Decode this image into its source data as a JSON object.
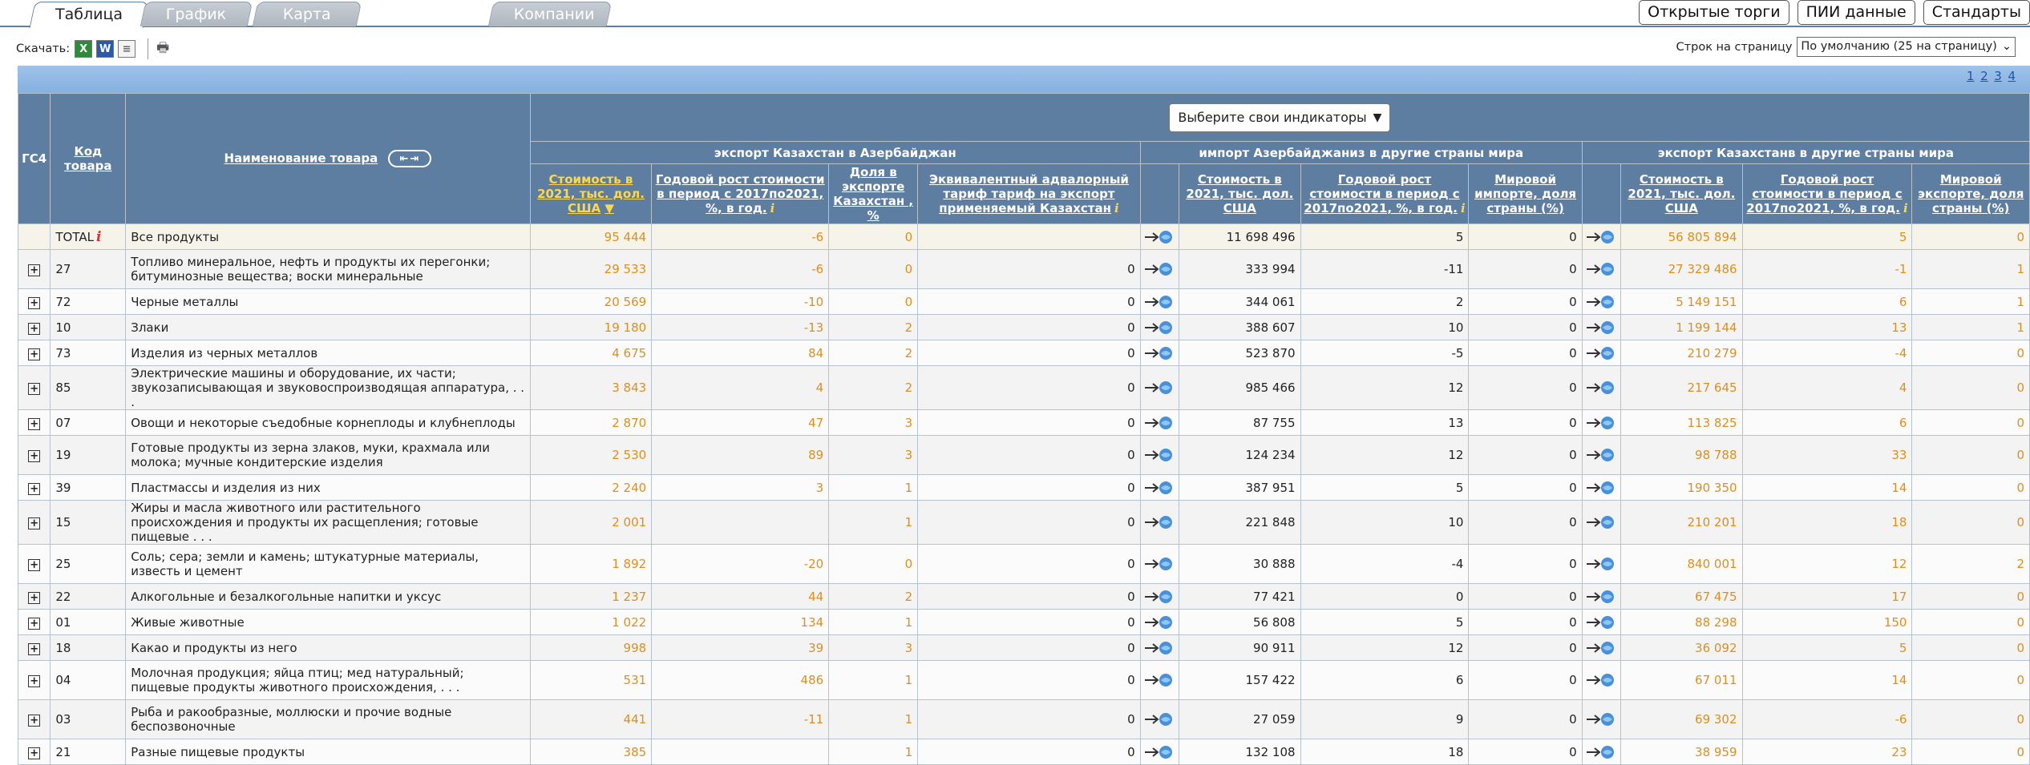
{
  "tabs": [
    {
      "label": "Таблица",
      "active": true
    },
    {
      "label": "График",
      "active": false
    },
    {
      "label": "Карта",
      "active": false
    },
    {
      "label": "Компании",
      "active": false
    }
  ],
  "top_buttons": [
    "Открытые торги",
    "ПИИ данные",
    "Стандарты"
  ],
  "toolbar": {
    "download_label": "Скачать:",
    "icons": [
      "excel-icon",
      "word-icon",
      "text-file-icon",
      "print-icon"
    ],
    "rows_label": "Строк на страницу",
    "rows_value": "По умолчанию (25 на страницу)"
  },
  "pager": [
    "1",
    "2",
    "3",
    "4"
  ],
  "header": {
    "col_gc4": "ГС4",
    "col_code": "Код товара",
    "col_name": "Наименование товара",
    "indicator_button": "Выберите свои индикаторы",
    "group1": "экспорт Казахстан в Азербайджан",
    "group2": "импорт Азербайджаниз в другие страны мира",
    "group3": "экспорт Казахстанв в другие страны мира",
    "g1_cols": [
      "Стоимость в 2021, тыс. дол. США",
      "Годовой рост стоимости в период с 2017по2021, %, в год.",
      "Доля в экспорте Казахстан , %",
      "Эквивалентный адвалорный тариф тариф на экспорт применяемый Казахстан"
    ],
    "g2_cols": [
      "Стоимость в 2021, тыс. дол. США",
      "Годовой рост стоимости в период с 2017по2021, %, в год.",
      "Мировой импорте, доля страны (%)"
    ],
    "g3_cols": [
      "Стоимость в 2021, тыс. дол. США",
      "Годовой рост стоимости в период с 2017по2021, %, в год.",
      "Мировой экспорте, доля страны (%)"
    ]
  },
  "rows": [
    {
      "code": "TOTAL",
      "name": "Все продукты",
      "v1": "95 444",
      "g1": "-6",
      "s1": "0",
      "t1": "",
      "v2": "11 698 496",
      "g2": "5",
      "s2": "0",
      "v3": "56 805 894",
      "g3": "5",
      "s3": "0",
      "total": true
    },
    {
      "code": "27",
      "name": "Топливо минеральное, нефть и продукты их перегонки; битуминозные вещества; воски минеральные",
      "v1": "29 533",
      "g1": "-6",
      "s1": "0",
      "t1": "0",
      "v2": "333 994",
      "g2": "-11",
      "s2": "0",
      "v3": "27 329 486",
      "g3": "-1",
      "s3": "1",
      "tall": true
    },
    {
      "code": "72",
      "name": "Черные металлы",
      "v1": "20 569",
      "g1": "-10",
      "s1": "0",
      "t1": "0",
      "v2": "344 061",
      "g2": "2",
      "s2": "0",
      "v3": "5 149 151",
      "g3": "6",
      "s3": "1"
    },
    {
      "code": "10",
      "name": "Злаки",
      "v1": "19 180",
      "g1": "-13",
      "s1": "2",
      "t1": "0",
      "v2": "388 607",
      "g2": "10",
      "s2": "0",
      "v3": "1 199 144",
      "g3": "13",
      "s3": "1"
    },
    {
      "code": "73",
      "name": "Изделия из черных металлов",
      "v1": "4 675",
      "g1": "84",
      "s1": "2",
      "t1": "0",
      "v2": "523 870",
      "g2": "-5",
      "s2": "0",
      "v3": "210 279",
      "g3": "-4",
      "s3": "0"
    },
    {
      "code": "85",
      "name": "Электрические машины и оборудование, их части; звукозаписывающая и звуковоспроизводящая аппаратура, . . .",
      "v1": "3 843",
      "g1": "4",
      "s1": "2",
      "t1": "0",
      "v2": "985 466",
      "g2": "12",
      "s2": "0",
      "v3": "217 645",
      "g3": "4",
      "s3": "0",
      "tall": true
    },
    {
      "code": "07",
      "name": "Овощи и некоторые съедобные корнеплоды и клубнеплоды",
      "v1": "2 870",
      "g1": "47",
      "s1": "3",
      "t1": "0",
      "v2": "87 755",
      "g2": "13",
      "s2": "0",
      "v3": "113 825",
      "g3": "6",
      "s3": "0"
    },
    {
      "code": "19",
      "name": "Готовые продукты из зерна злаков, муки, крахмала или молока; мучные кондитерские изделия",
      "v1": "2 530",
      "g1": "89",
      "s1": "3",
      "t1": "0",
      "v2": "124 234",
      "g2": "12",
      "s2": "0",
      "v3": "98 788",
      "g3": "33",
      "s3": "0",
      "tall": true
    },
    {
      "code": "39",
      "name": "Пластмассы и изделия из них",
      "v1": "2 240",
      "g1": "3",
      "s1": "1",
      "t1": "0",
      "v2": "387 951",
      "g2": "5",
      "s2": "0",
      "v3": "190 350",
      "g3": "14",
      "s3": "0"
    },
    {
      "code": "15",
      "name": "Жиры и масла животного или растительного происхождения и продукты их расщепления; готовые пищевые . . .",
      "v1": "2 001",
      "g1": "",
      "s1": "1",
      "t1": "0",
      "v2": "221 848",
      "g2": "10",
      "s2": "0",
      "v3": "210 201",
      "g3": "18",
      "s3": "0",
      "tall": true
    },
    {
      "code": "25",
      "name": "Соль; сера; земли и камень; штукатурные материалы, известь и цемент",
      "v1": "1 892",
      "g1": "-20",
      "s1": "0",
      "t1": "0",
      "v2": "30 888",
      "g2": "-4",
      "s2": "0",
      "v3": "840 001",
      "g3": "12",
      "s3": "2",
      "tall": true
    },
    {
      "code": "22",
      "name": "Алкогольные и безалкогольные напитки и уксус",
      "v1": "1 237",
      "g1": "44",
      "s1": "2",
      "t1": "0",
      "v2": "77 421",
      "g2": "0",
      "s2": "0",
      "v3": "67 475",
      "g3": "17",
      "s3": "0"
    },
    {
      "code": "01",
      "name": "Живые животные",
      "v1": "1 022",
      "g1": "134",
      "s1": "1",
      "t1": "0",
      "v2": "56 808",
      "g2": "5",
      "s2": "0",
      "v3": "88 298",
      "g3": "150",
      "s3": "0"
    },
    {
      "code": "18",
      "name": "Какао и продукты из него",
      "v1": "998",
      "g1": "39",
      "s1": "3",
      "t1": "0",
      "v2": "90 911",
      "g2": "12",
      "s2": "0",
      "v3": "36 092",
      "g3": "5",
      "s3": "0"
    },
    {
      "code": "04",
      "name": "Молочная продукция; яйца птиц; мед натуральный; пищевые продукты животного происхождения, . . .",
      "v1": "531",
      "g1": "486",
      "s1": "1",
      "t1": "0",
      "v2": "157 422",
      "g2": "6",
      "s2": "0",
      "v3": "67 011",
      "g3": "14",
      "s3": "0",
      "tall": true
    },
    {
      "code": "03",
      "name": "Рыба и ракообразные, моллюски и прочие водные беспозвоночные",
      "v1": "441",
      "g1": "-11",
      "s1": "1",
      "t1": "0",
      "v2": "27 059",
      "g2": "9",
      "s2": "0",
      "v3": "69 302",
      "g3": "-6",
      "s3": "0",
      "tall": true
    },
    {
      "code": "21",
      "name": "Разные пищевые продукты",
      "v1": "385",
      "g1": "",
      "s1": "1",
      "t1": "0",
      "v2": "132 108",
      "g2": "18",
      "s2": "0",
      "v3": "38 959",
      "g3": "23",
      "s3": "0"
    }
  ]
}
